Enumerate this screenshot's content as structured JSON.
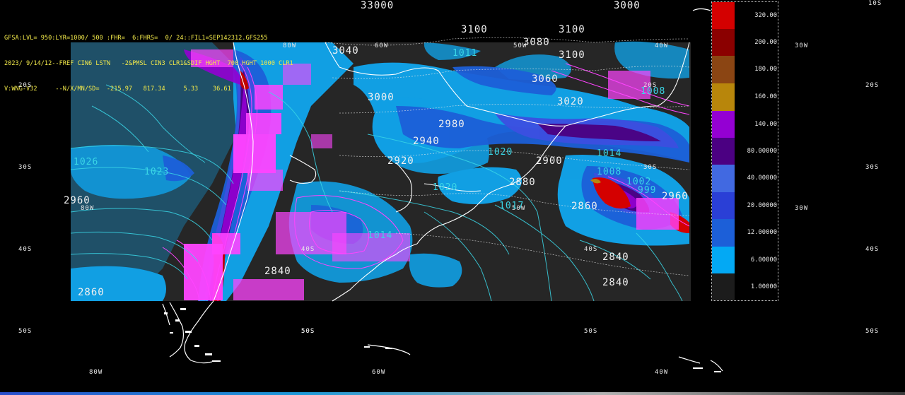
{
  "header": {
    "line1": "GFSA:LVL= 950:LYR=1000/ 500 :FHR=  6:FHRS=  0/ 24::FIL1=SEP142312.GFS255",
    "line2": "2023/ 9/14/12--FREF CIN6 LSTN   -2&PMSL CIN3 CLR1&SDIF HGHT  700 HGHT 1000 CLR1",
    "line3": "V:WNG-V32     --N/X/MN/SD=  -215.97   817.34     5.33    36.61"
  },
  "colorbar": {
    "labels": [
      "320.00",
      "200.00",
      "180.00",
      "160.00",
      "140.00",
      "80.00000",
      "40.00000",
      "20.00000",
      "12.00000",
      "6.00000",
      "1.00000"
    ],
    "colors": [
      "#d40000",
      "#8b0000",
      "#8b4513",
      "#b8860b",
      "#9400d3",
      "#4b0082",
      "#4169e1",
      "#2a3fd6",
      "#1c5fd8",
      "#03a9f4",
      "#1c1c1c"
    ]
  },
  "latitude_labels": {
    "left": [
      "20S",
      "30S",
      "40S",
      "50S"
    ],
    "right": [
      "10S",
      "20S",
      "30S",
      "40S",
      "50S"
    ],
    "inner": [
      "20S",
      "30S",
      "40S",
      "50S",
      "50S",
      "40S",
      "50S"
    ]
  },
  "longitude_labels": [
    "80W",
    "60W",
    "40W",
    "30W",
    "30W",
    "80W",
    "50W",
    "60W",
    "40W",
    "80W",
    "50W"
  ],
  "contour_labels": {
    "height_700": [
      "3100",
      "3100",
      "3100",
      "3080",
      "3060",
      "3040",
      "3020",
      "3000",
      "2980",
      "2960",
      "2940",
      "2920",
      "2900",
      "2880",
      "2860",
      "2860",
      "2840",
      "2840",
      "2840",
      "2960",
      "33000",
      "3000"
    ],
    "pressure": [
      "1026",
      "1023",
      "1020",
      "1020",
      "1017",
      "1014",
      "1014",
      "1011",
      "1008",
      "1002",
      "999",
      "1008"
    ]
  }
}
